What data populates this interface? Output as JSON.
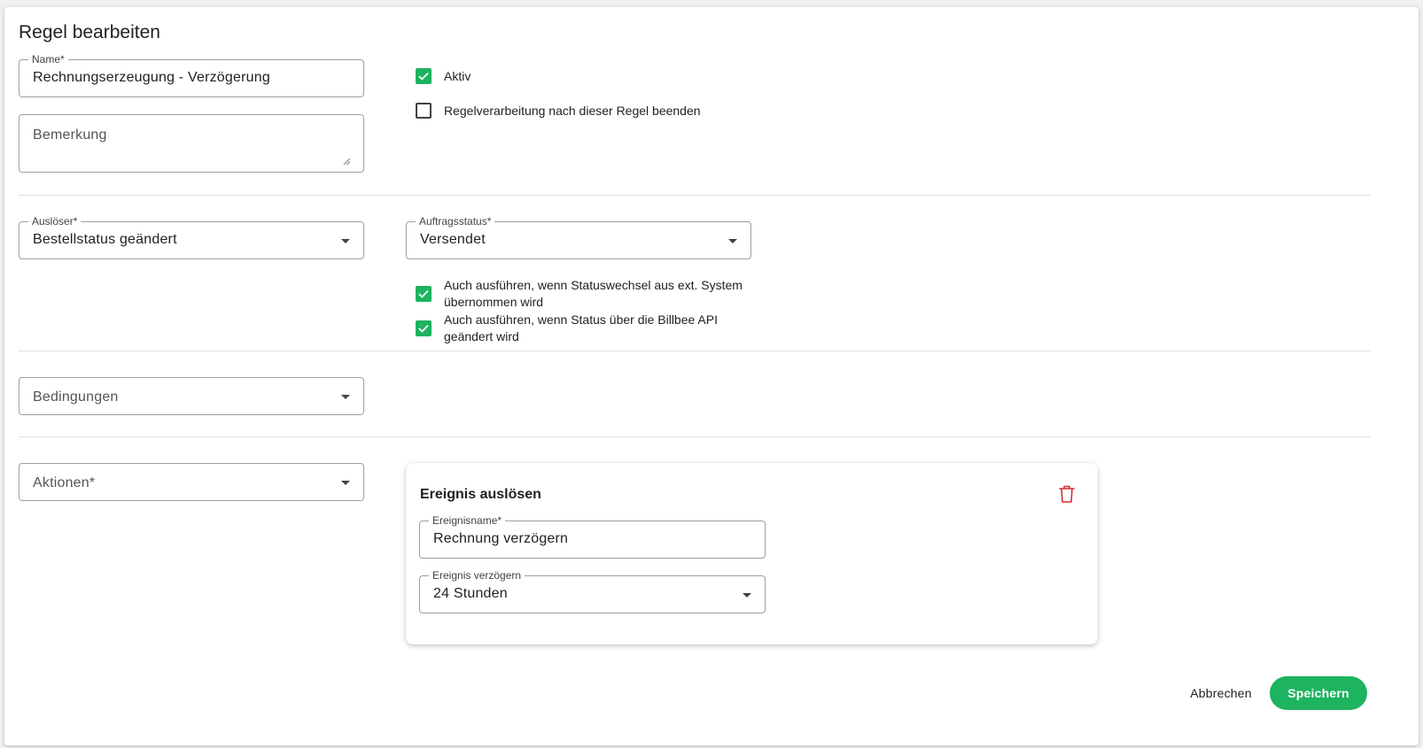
{
  "dialog": {
    "title": "Regel bearbeiten"
  },
  "name_field": {
    "label": "Name*",
    "value": "Rechnungserzeugung - Verzögerung"
  },
  "remark_field": {
    "placeholder": "Bemerkung"
  },
  "active_checkbox": {
    "label": "Aktiv",
    "checked": true
  },
  "stop_processing_checkbox": {
    "label": "Regelverarbeitung nach dieser Regel beenden",
    "checked": false
  },
  "trigger_field": {
    "label": "Auslöser*",
    "value": "Bestellstatus geändert"
  },
  "order_status_field": {
    "label": "Auftragsstatus*",
    "value": "Versendet"
  },
  "ext_system_checkbox": {
    "label_line1": "Auch ausführen, wenn Statuswechsel aus ext. System",
    "label_line2": "übernommen wird",
    "checked": true
  },
  "api_checkbox": {
    "label_line1": "Auch ausführen, wenn Status über die Billbee API",
    "label_line2": "geändert wird",
    "checked": true
  },
  "conditions_field": {
    "placeholder": "Bedingungen"
  },
  "actions_field": {
    "placeholder": "Aktionen*"
  },
  "action_card": {
    "title": "Ereignis auslösen",
    "event_name_field": {
      "label": "Ereignisname*",
      "value": "Rechnung verzögern"
    },
    "event_delay_field": {
      "label": "Ereignis verzögern",
      "value": "24 Stunden"
    },
    "delete_icon": "trash-icon"
  },
  "footer": {
    "cancel_label": "Abbrechen",
    "save_label": "Speichern"
  },
  "colors": {
    "accent": "#1db35f",
    "danger": "#d32f2f"
  }
}
